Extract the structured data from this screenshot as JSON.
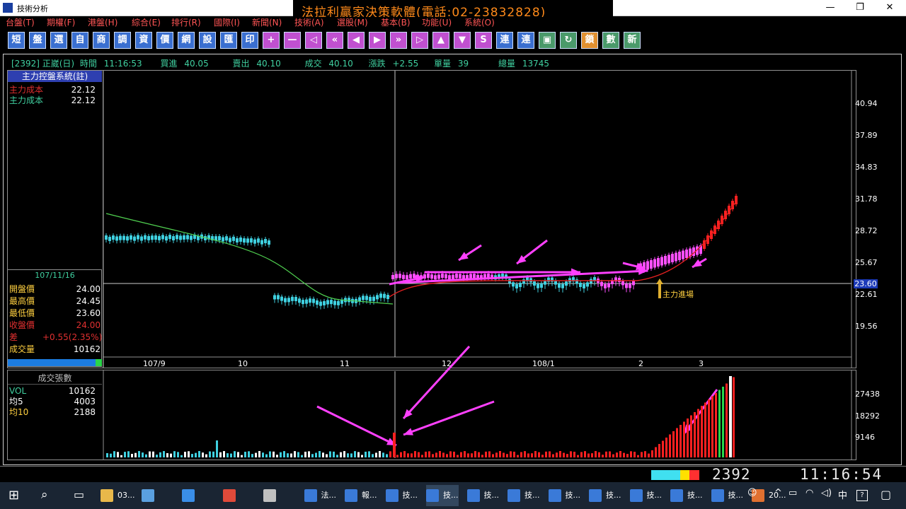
{
  "window": {
    "title": "技術分析",
    "banner": "法拉利贏家決策軟體(電話:02-23832828)",
    "controls": {
      "minimize": "—",
      "restore": "❐",
      "close": "✕"
    }
  },
  "menu": [
    "台盤(T)",
    "期權(F)",
    "港盤(H)",
    "綜合(E)",
    "排行(R)",
    "國際(I)",
    "新聞(N)",
    "技術(A)",
    "選股(M)",
    "基本(B)",
    "功能(U)",
    "系統(O)"
  ],
  "toolbar": [
    {
      "label": "短",
      "icon": "short-term-icon"
    },
    {
      "label": "盤",
      "icon": "board-icon"
    },
    {
      "label": "選",
      "icon": "select-icon"
    },
    {
      "label": "自",
      "icon": "custom-icon"
    },
    {
      "label": "商",
      "icon": "commodity-icon"
    },
    {
      "label": "調",
      "icon": "adjust-icon"
    },
    {
      "label": "資",
      "icon": "data-icon"
    },
    {
      "label": "價",
      "icon": "price-icon"
    },
    {
      "label": "網",
      "icon": "web-icon"
    },
    {
      "label": "設",
      "icon": "settings-icon"
    },
    {
      "label": "匯",
      "icon": "export-icon"
    },
    {
      "label": "印",
      "icon": "print-icon"
    },
    {
      "label": "+",
      "icon": "zoom-in-icon"
    },
    {
      "label": "—",
      "icon": "zoom-out-icon"
    },
    {
      "label": "◁",
      "icon": "first-icon"
    },
    {
      "label": "«",
      "icon": "fast-back-icon"
    },
    {
      "label": "◀",
      "icon": "back-icon"
    },
    {
      "label": "▶",
      "icon": "forward-icon"
    },
    {
      "label": "»",
      "icon": "fast-forward-icon"
    },
    {
      "label": "▷",
      "icon": "last-icon"
    },
    {
      "label": "▲",
      "icon": "up-icon"
    },
    {
      "label": "▼",
      "icon": "down-icon"
    },
    {
      "label": "S",
      "icon": "esc-icon"
    },
    {
      "label": "連",
      "icon": "link-icon"
    },
    {
      "label": "連",
      "icon": "link2-icon"
    },
    {
      "label": "▣",
      "icon": "window-icon"
    },
    {
      "label": "↻",
      "icon": "refresh-icon"
    },
    {
      "label": "鎖",
      "icon": "lock-icon"
    },
    {
      "label": "數",
      "icon": "calc-icon"
    },
    {
      "label": "新",
      "icon": "new-icon"
    }
  ],
  "quote": {
    "code_name": "[2392] 正崴(日)",
    "time_label": "時間",
    "time": "11:16:53",
    "bid_label": "買進",
    "bid": "40.05",
    "ask_label": "賣出",
    "ask": "40.10",
    "last_label": "成交",
    "last": "40.10",
    "change_label": "漲跌",
    "change": "+2.55",
    "unit_label": "單量",
    "unit": "39",
    "total_label": "總量",
    "total": "13745"
  },
  "indicator": {
    "header": "主力控盤系統(註)",
    "rows": [
      {
        "label": "主力成本",
        "value": "22.12",
        "color": "#e03030"
      },
      {
        "label": "主力成本",
        "value": "22.12",
        "color": "#40d0a0"
      }
    ]
  },
  "daybox": {
    "date": "107/11/16",
    "rows": [
      {
        "label": "開盤價",
        "value": "24.00",
        "color": "#ffd040"
      },
      {
        "label": "最高價",
        "value": "24.45",
        "color": "#ffd040"
      },
      {
        "label": "最低價",
        "value": "23.60",
        "color": "#ffd040"
      },
      {
        "label": "收盤價",
        "value": "24.00",
        "color": "#e03030"
      },
      {
        "label": "差",
        "value": "+0.55(2.35%)",
        "color": "#e03030"
      },
      {
        "label": "成交量",
        "value": "10162",
        "color": "#ffd040"
      }
    ]
  },
  "price_axis": [
    "40.94",
    "37.89",
    "34.83",
    "31.78",
    "28.72",
    "25.67",
    "22.61",
    "19.56"
  ],
  "price_current": "23.60",
  "time_axis": [
    "107/9",
    "10",
    "11",
    "12",
    "108/1",
    "2",
    "3"
  ],
  "annotation": "主力進場",
  "volume": {
    "header": "成交張數",
    "rows": [
      {
        "label": "VOL",
        "value": "10162",
        "color": "#40d0a0"
      },
      {
        "label": "均5",
        "value": "4003",
        "color": "#ffffff"
      },
      {
        "label": "均10",
        "value": "2188",
        "color": "#ffd040"
      }
    ],
    "axis": [
      "27438",
      "18292",
      "9146"
    ]
  },
  "status": {
    "code": "2392",
    "clock": "11:16:54"
  },
  "taskbar": {
    "items": [
      {
        "label": "03...",
        "icon": "folder-icon"
      },
      {
        "label": "",
        "icon": "computer-icon"
      },
      {
        "label": "",
        "icon": "ie-icon"
      },
      {
        "label": "",
        "icon": "chrome-icon"
      },
      {
        "label": "",
        "icon": "tool-icon"
      },
      {
        "label": "法...",
        "icon": "app-icon"
      },
      {
        "label": "報...",
        "icon": "chart-app-icon"
      },
      {
        "label": "技...",
        "icon": "chart-app-icon"
      },
      {
        "label": "技...",
        "icon": "chart-app-icon"
      },
      {
        "label": "技...",
        "icon": "chart-app-icon"
      },
      {
        "label": "技...",
        "icon": "chart-app-icon"
      },
      {
        "label": "技...",
        "icon": "chart-app-icon"
      },
      {
        "label": "技...",
        "icon": "chart-app-icon"
      },
      {
        "label": "技...",
        "icon": "chart-app-icon"
      },
      {
        "label": "技...",
        "icon": "chart-app-icon"
      },
      {
        "label": "技...",
        "icon": "chart-app-icon"
      },
      {
        "label": "20...",
        "icon": "office-icon"
      }
    ],
    "ime": "中"
  }
}
